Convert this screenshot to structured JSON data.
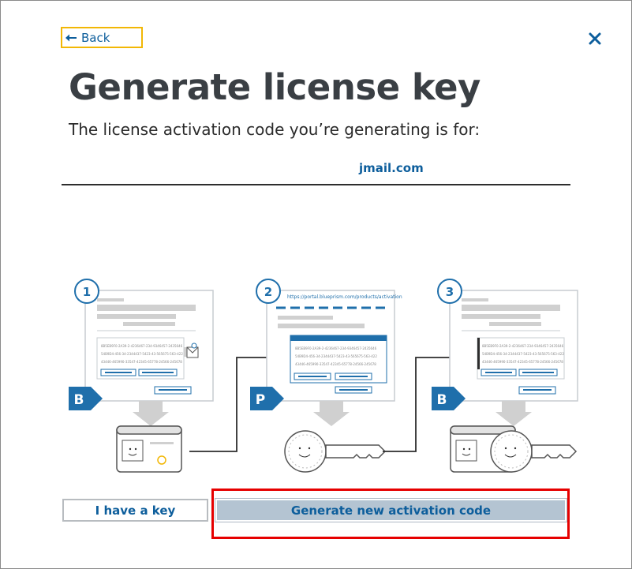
{
  "header": {
    "back_label": "Back",
    "title": "Generate license key",
    "subtitle": "The license activation code you’re generating is for:"
  },
  "account": {
    "email": "jmail.com"
  },
  "steps": [
    {
      "number": "1",
      "badge": "B"
    },
    {
      "number": "2",
      "badge": "P",
      "url": "https://portal.blueprism.com/products/activation"
    },
    {
      "number": "3",
      "badge": "B"
    }
  ],
  "code_lines": [
    "8B5EB9F0-2A39-2-4236467-234-9346457-2435646",
    "54B9D4-456-34-2344437-5423-43-565675-563-422",
    "43446-465990-33547-42345-65778-24566-245678"
  ],
  "buttons": {
    "have_key": "I have a key",
    "generate": "Generate new activation code"
  },
  "colors": {
    "accent": "#0d5e9c",
    "focus": "#f2b705",
    "highlight": "#e60000"
  },
  "icons": {
    "back": "arrow-left-icon",
    "close": "close-icon"
  }
}
